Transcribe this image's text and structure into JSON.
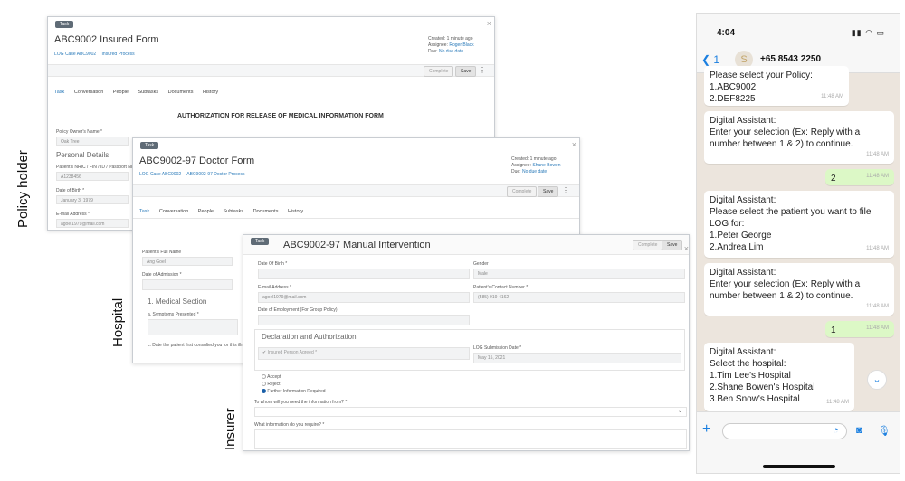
{
  "labels": {
    "policy_holder": "Policy holder",
    "hospital": "Hospital",
    "insurer": "Insurer"
  },
  "win1": {
    "chip": "Task",
    "title": "ABC9002 Insured Form",
    "link1": "LOG Case ABC9002",
    "link2": "Insured Process",
    "created": "Created: 1 minute ago",
    "assignee_prefix": "Assignee: ",
    "assignee": "Roger Black",
    "due_prefix": "Due: ",
    "due": "No due date",
    "complete": "Complete",
    "save": "Save",
    "tabs": [
      "Task",
      "Conversation",
      "People",
      "Subtasks",
      "Documents",
      "History"
    ],
    "form_heading": "AUTHORIZATION FOR RELEASE OF MEDICAL INFORMATION FORM",
    "owner_label": "Policy Owner's Name *",
    "owner_value": "Oak Tree",
    "personal_details": "Personal Details",
    "nric_label": "Patient's NRIC / FIN / ID / Passport Numb",
    "nric_value": "A1238456",
    "dob_label": "Date of Birth *",
    "dob_value": "January 3, 1979",
    "email_label": "E-mail Address *",
    "email_value": "agoel1979@mail.com"
  },
  "win2": {
    "chip": "Task",
    "title": "ABC9002-97 Doctor Form",
    "link1": "LOG Case ABC9002",
    "link2": "ABC9002-97 Doctor Process",
    "created": "Created: 1 minute ago",
    "assignee_prefix": "Assignee: ",
    "assignee": "Shane Bowen",
    "due_prefix": "Due: ",
    "due": "No due date",
    "complete": "Complete",
    "save": "Save",
    "tabs": [
      "Task",
      "Conversation",
      "People",
      "Subtasks",
      "Documents",
      "History"
    ],
    "patient_label": "Patient's Full Name",
    "patient_value": "Ang Goel",
    "admission_label": "Date of Admission *",
    "medical_section": "1. Medical Section",
    "symptoms_label": "a. Symptoms Presented *",
    "consult_label": "c. Date the patient first consulted you for this illness"
  },
  "win3": {
    "chip": "Task",
    "title": "ABC9002-97 Manual Intervention",
    "complete": "Complete",
    "save": "Save",
    "dob_label": "Date Of Birth *",
    "gender_label": "Gender",
    "gender_value": "Male",
    "email_label": "E-mail Address *",
    "email_value": "agoel1979@mail.com",
    "contact_label": "Patient's Contact Number *",
    "contact_value": "(585) 919-4162",
    "employment_label": "Date of Employment (For Group Policy)",
    "decl_heading": "Declaration and Authorization",
    "agreed_label": "Insured Person Agreed *",
    "log_date_label": "LOG Submission Date *",
    "log_date_value": "May 15, 2021",
    "radio_accept": "Accept",
    "radio_reject": "Reject",
    "radio_further": "Further Information Required",
    "whom_label": "To whom will you need the information from? *",
    "what_label": "What information do you require? *"
  },
  "phone": {
    "time": "4:04",
    "back": "1",
    "avatar": "S",
    "contact": "+65 8543 2250",
    "messages": [
      {
        "text": "Please select your Policy:\n1.ABC9002\n2.DEF8225",
        "time": "11:48 AM"
      },
      {
        "text": "Digital Assistant:\nEnter your selection (Ex: Reply with a number between 1 & 2) to continue.",
        "time": "11:48 AM"
      },
      {
        "text": "2",
        "time": "11:48 AM"
      },
      {
        "text": "Digital Assistant:\nPlease select the patient you want to file LOG for:\n1.Peter George\n2.Andrea Lim",
        "time": "11:48 AM"
      },
      {
        "text": "Digital Assistant:\nEnter your selection (Ex: Reply with a number between 1 & 2) to continue.",
        "time": "11:48 AM"
      },
      {
        "text": "1",
        "time": "11:48 AM"
      },
      {
        "text": "Digital Assistant:\nSelect the hospital:\n1.Tim Lee's Hospital\n2.Shane Bowen's Hospital\n3.Ben Snow's Hospital",
        "time": "11:48 AM"
      }
    ]
  }
}
